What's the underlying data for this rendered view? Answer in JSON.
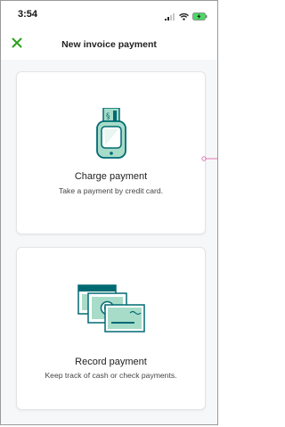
{
  "status_bar": {
    "time": "3:54",
    "icons": [
      "signal-icon",
      "wifi-icon",
      "battery-charging-icon"
    ]
  },
  "header": {
    "title": "New invoice payment",
    "close_icon": "close-icon"
  },
  "options": {
    "charge": {
      "title": "Charge payment",
      "subtitle": "Take a payment by credit card.",
      "icon": "card-reader-icon"
    },
    "record": {
      "title": "Record payment",
      "subtitle": "Keep track of cash or check payments.",
      "icon": "cash-and-check-icon"
    }
  },
  "colors": {
    "accent_green": "#2ca01c",
    "illustration_teal": "#006a73",
    "illustration_mint": "#a7dcc9",
    "background": "#f6f7f8"
  }
}
